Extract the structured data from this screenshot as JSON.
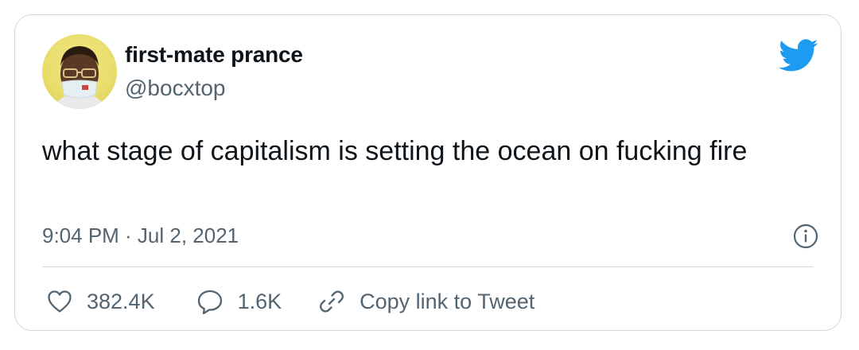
{
  "user": {
    "display_name": "first-mate prance",
    "handle": "@bocxtop"
  },
  "tweet": {
    "text": "what stage of capitalism is setting the ocean on fucking fire",
    "timestamp": "9:04 PM · Jul 2, 2021"
  },
  "actions": {
    "likes": "382.4K",
    "replies": "1.6K",
    "copy_link": "Copy link to Tweet"
  },
  "icons": {
    "logo": "twitter-bird-icon",
    "info": "info-icon",
    "like": "heart-icon",
    "reply": "speech-bubble-icon",
    "link": "link-icon"
  },
  "colors": {
    "twitter_blue": "#1d9bf0",
    "text_primary": "#0f1419",
    "text_secondary": "#536471",
    "border": "#cfd9de"
  }
}
